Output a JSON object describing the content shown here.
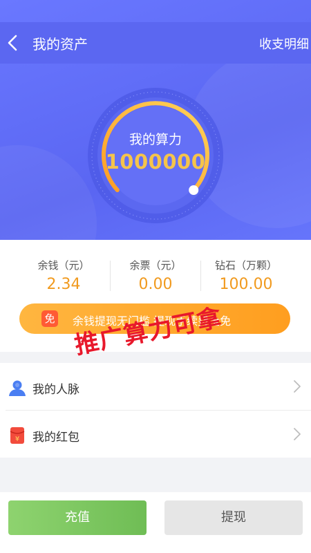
{
  "header": {
    "title": "我的资产",
    "detail_link": "收支明细"
  },
  "gauge": {
    "label": "我的算力",
    "value": "1000000"
  },
  "stats": [
    {
      "label": "余钱（元）",
      "value": "2.34"
    },
    {
      "label": "余票（元）",
      "value": "0.00"
    },
    {
      "label": "钻石（万颗）",
      "value": "100.00"
    }
  ],
  "promo": {
    "badge": "免",
    "text": "余钱提现无门槛 提现手续费全免"
  },
  "watermark": "推广算力可拿",
  "menu": [
    {
      "label": "我的人脉",
      "icon": "contacts-icon"
    },
    {
      "label": "我的红包",
      "icon": "red-envelope-icon"
    }
  ],
  "buttons": {
    "recharge": "充值",
    "withdraw": "提现"
  },
  "colors": {
    "primary": "#5b67f1",
    "accent": "#f19a1e",
    "green": "#78c45c",
    "watermark": "#e8182b"
  }
}
